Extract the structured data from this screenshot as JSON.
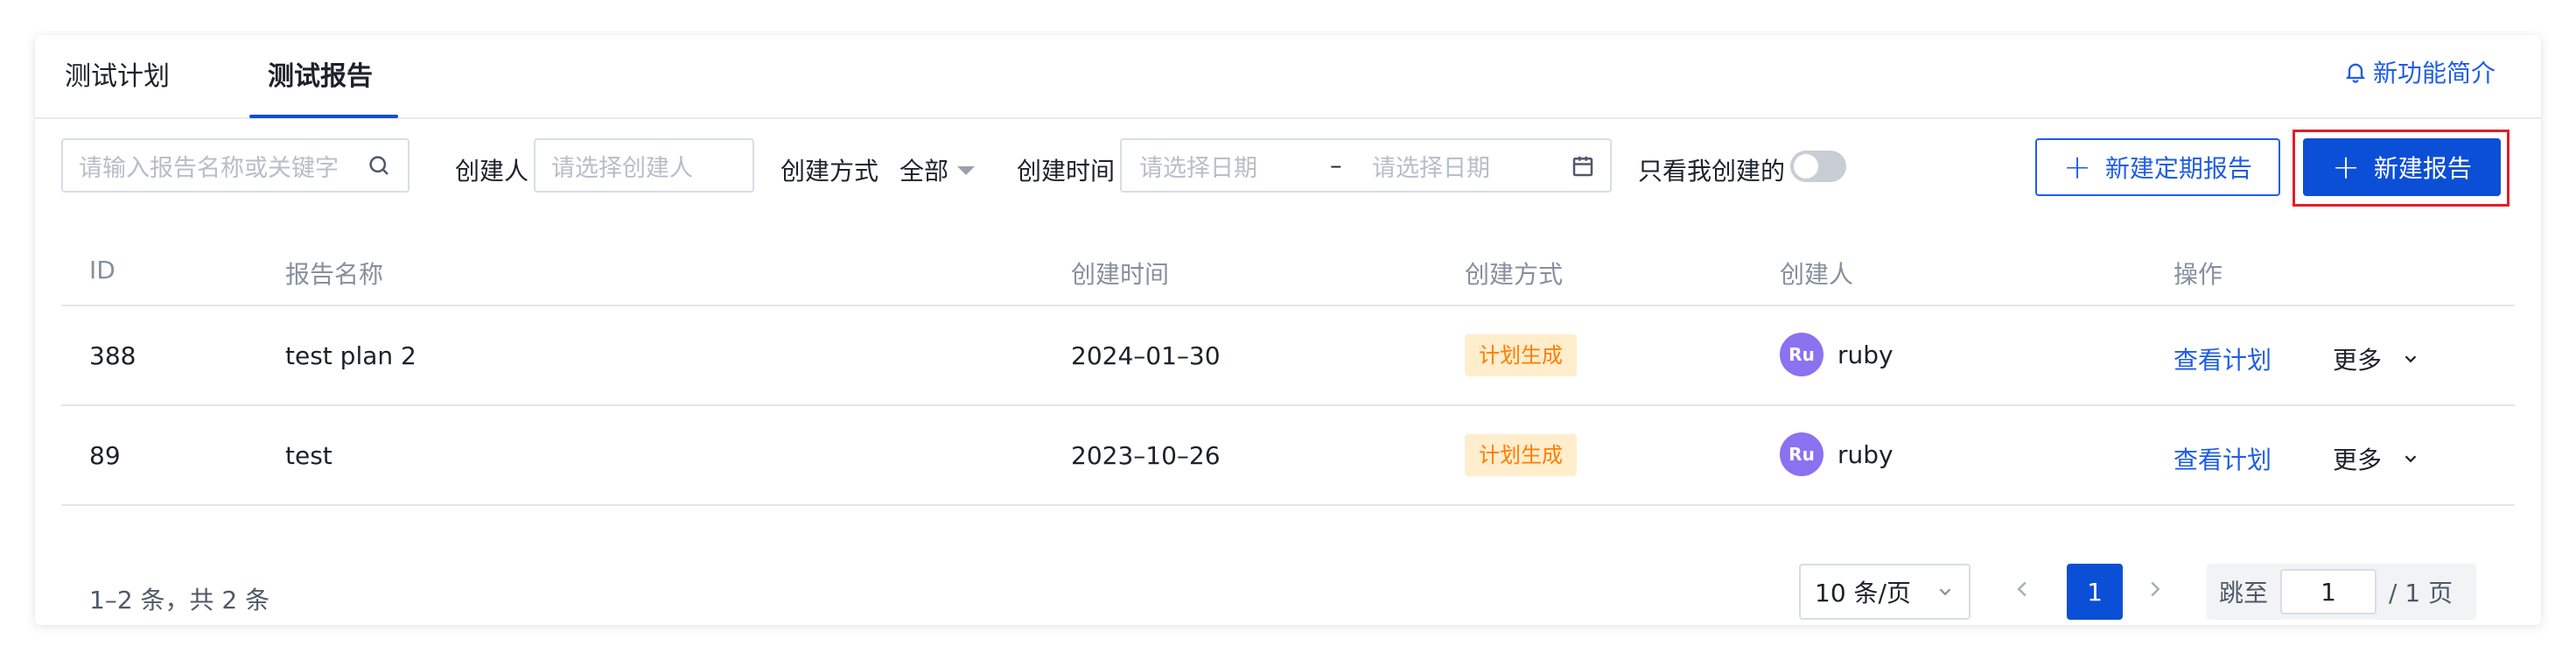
{
  "tabs": [
    {
      "label": "测试计划",
      "active": false
    },
    {
      "label": "测试报告",
      "active": true
    }
  ],
  "whats_new": {
    "label": "新功能简介",
    "icon": "bell-icon"
  },
  "filters": {
    "search_placeholder": "请输入报告名称或关键字",
    "creator_label": "创建人",
    "creator_placeholder": "请选择创建人",
    "method_label": "创建方式",
    "method_value": "全部",
    "time_label": "创建时间",
    "start_placeholder": "请选择日期",
    "range_separator": "–",
    "end_placeholder": "请选择日期",
    "mine_only_label": "只看我创建的",
    "mine_only_on": false
  },
  "actions": {
    "new_scheduled": "新建定期报告",
    "new_report": "新建报告"
  },
  "table": {
    "headers": [
      "ID",
      "报告名称",
      "创建时间",
      "创建方式",
      "创建人",
      "操作"
    ],
    "rows": [
      {
        "id": "388",
        "name": "test plan 2",
        "created": "2024–01–30",
        "method": "计划生成",
        "creator_initials": "Ru",
        "creator": "ruby",
        "view": "查看计划",
        "more": "更多"
      },
      {
        "id": "89",
        "name": "test",
        "created": "2023–10–26",
        "method": "计划生成",
        "creator_initials": "Ru",
        "creator": "ruby",
        "view": "查看计划",
        "more": "更多"
      }
    ]
  },
  "pagination": {
    "total_text": "1–2 条，共 2 条",
    "page_size": "10 条/页",
    "current_page": "1",
    "jump_label": "跳至",
    "jump_value": "1",
    "page_total": "/ 1 页"
  },
  "colors": {
    "primary": "#0b4fd6",
    "link": "#1f5de6",
    "tag_bg": "#ffedcc",
    "tag_text": "#ff7d00",
    "highlight": "#e01e2b"
  }
}
